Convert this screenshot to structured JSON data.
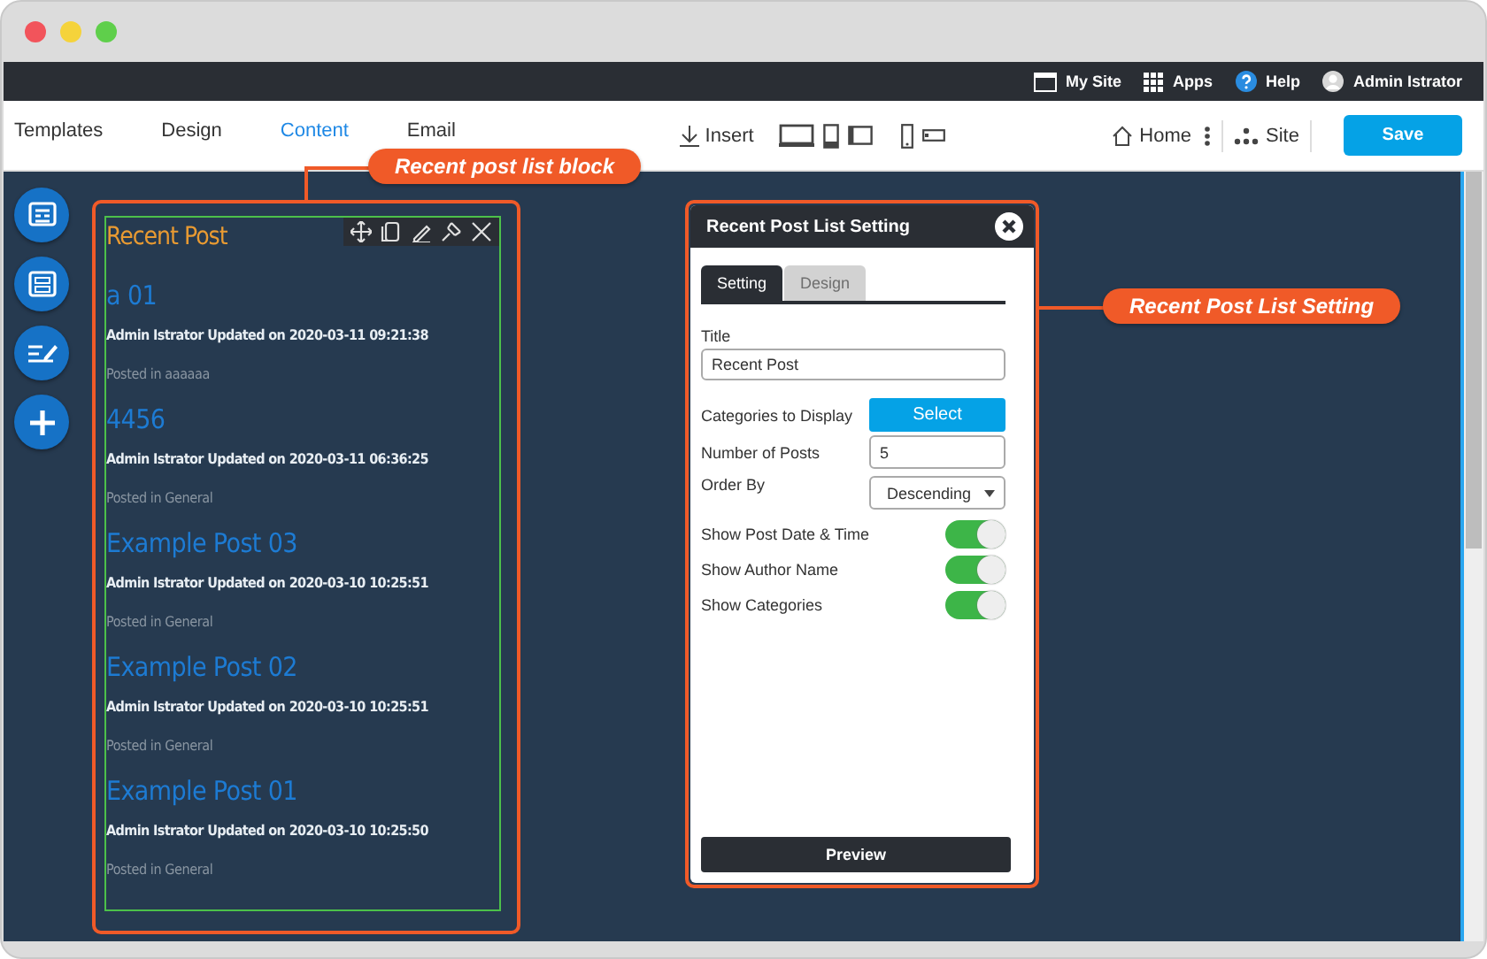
{
  "window_controls": [
    {
      "color": "#f2545b"
    },
    {
      "color": "#f5d33b"
    },
    {
      "color": "#5fcf4b"
    }
  ],
  "top_bar": {
    "items": [
      {
        "kind": "site",
        "label": "My Site"
      },
      {
        "kind": "apps",
        "label": "Apps"
      },
      {
        "kind": "help",
        "label": "Help"
      },
      {
        "kind": "user",
        "label": "Admin Istrator"
      }
    ]
  },
  "nav": {
    "tabs": [
      {
        "label": "Templates",
        "selected": false
      },
      {
        "label": "Design",
        "selected": false
      },
      {
        "label": "Content",
        "selected": true
      },
      {
        "label": "Email",
        "selected": false
      }
    ],
    "insert": "Insert",
    "home": "Home",
    "site": "Site",
    "save": "Save"
  },
  "post_block": {
    "title": "Recent Post",
    "posts": [
      {
        "title": "a 01",
        "meta": "Admin Istrator Updated on 2020-03-11 09:21:38",
        "category": "Posted in aaaaaa"
      },
      {
        "title": "4456",
        "meta": "Admin Istrator Updated on 2020-03-11 06:36:25",
        "category": "Posted in General"
      },
      {
        "title": "Example Post 03",
        "meta": "Admin Istrator Updated on 2020-03-10 10:25:51",
        "category": "Posted in General"
      },
      {
        "title": "Example Post 02",
        "meta": "Admin Istrator Updated on 2020-03-10 10:25:51",
        "category": "Posted in General"
      },
      {
        "title": "Example Post 01",
        "meta": "Admin Istrator Updated on 2020-03-10 10:25:50",
        "category": "Posted in General"
      }
    ]
  },
  "settings": {
    "title": "Recent Post List Setting",
    "tabs": [
      {
        "label": "Setting",
        "selected": true
      },
      {
        "label": "Design",
        "selected": false
      }
    ],
    "title_field": {
      "label": "Title",
      "value": "Recent Post"
    },
    "categories": {
      "label": "Categories to Display",
      "button": "Select"
    },
    "number_of_posts": {
      "label": "Number of Posts",
      "value": "5"
    },
    "order_by": {
      "label": "Order By",
      "value": "Descending"
    },
    "toggles": [
      {
        "label": "Show Post Date & Time",
        "on": true
      },
      {
        "label": "Show Author Name",
        "on": true
      },
      {
        "label": "Show Categories",
        "on": true
      }
    ],
    "preview": "Preview"
  },
  "callouts": [
    {
      "label": "Recent post list block"
    },
    {
      "label": "Recent Post List Setting"
    }
  ]
}
